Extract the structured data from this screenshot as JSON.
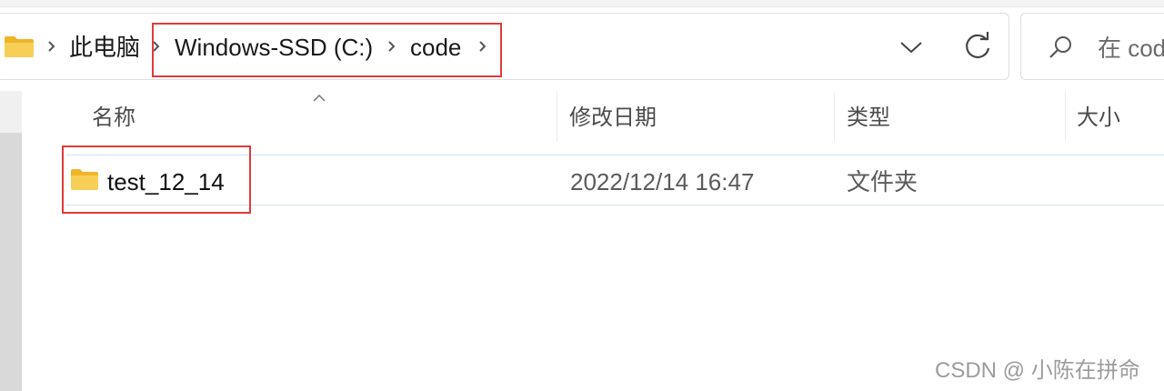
{
  "address_bar": {
    "breadcrumbs": [
      "此电脑",
      "Windows-SSD (C:)",
      "code"
    ]
  },
  "search": {
    "placeholder": "在 cod"
  },
  "columns": {
    "name": "名称",
    "date_modified": "修改日期",
    "type": "类型",
    "size": "大小"
  },
  "files": [
    {
      "name": "test_12_14",
      "date_modified": "2022/12/14 16:47",
      "type": "文件夹",
      "size": ""
    }
  ],
  "watermark": "CSDN @  小陈在拼命",
  "colors": {
    "highlight_box": "#e23a3a",
    "folder": "#f4c542",
    "row_border": "#cde6f7"
  },
  "icons": [
    "folder-icon",
    "chevron-right-icon",
    "chevron-down-icon",
    "refresh-icon",
    "search-icon",
    "sort-up-icon"
  ]
}
